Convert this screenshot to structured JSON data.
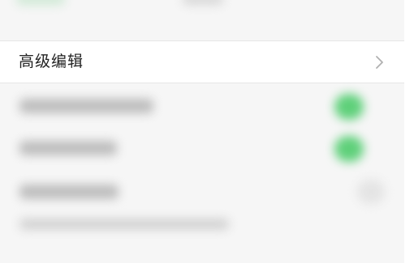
{
  "settings": {
    "advanced_edit_label": "高级编辑",
    "chevron_icon": "chevron-right-icon"
  },
  "colors": {
    "toggle_on": "#5fd07a",
    "toggle_off": "#e4e4e4",
    "row_background": "#ffffff",
    "page_background": "#f6f6f6"
  }
}
